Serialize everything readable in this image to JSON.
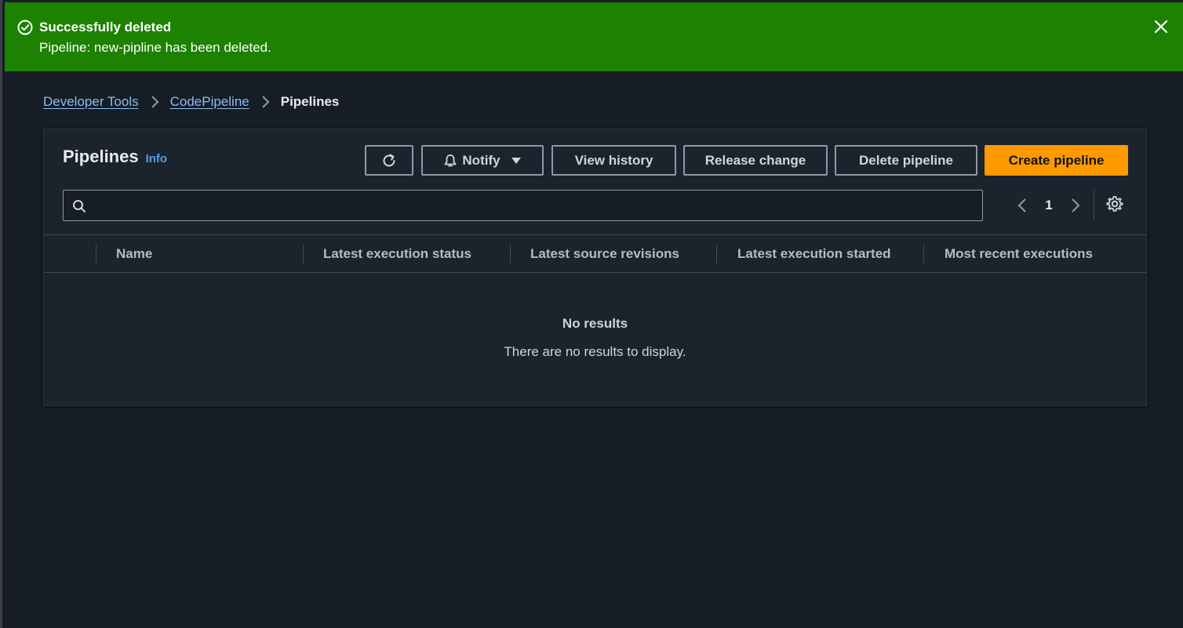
{
  "flash": {
    "title": "Successfully deleted",
    "message": "Pipeline: new-pipline has been deleted.",
    "background": "#1d8102"
  },
  "breadcrumb": {
    "items": [
      "Developer Tools",
      "CodePipeline"
    ],
    "current": "Pipelines"
  },
  "panel": {
    "title": "Pipelines",
    "info_label": "Info"
  },
  "toolbar": {
    "notify_label": "Notify",
    "view_history_label": "View history",
    "release_change_label": "Release change",
    "delete_pipeline_label": "Delete pipeline",
    "create_pipeline_label": "Create pipeline",
    "primary_color": "#ff9900"
  },
  "search": {
    "value": "",
    "placeholder": ""
  },
  "pagination": {
    "current_page": "1"
  },
  "table": {
    "columns": [
      "Name",
      "Latest execution status",
      "Latest source revisions",
      "Latest execution started",
      "Most recent executions"
    ]
  },
  "empty_state": {
    "title": "No results",
    "description": "There are no results to display."
  },
  "icons": [
    "check-circle-icon",
    "close-icon",
    "chevron-right-icon",
    "refresh-icon",
    "bell-icon",
    "caret-down-icon",
    "search-icon",
    "chevron-left-icon",
    "gear-icon"
  ]
}
